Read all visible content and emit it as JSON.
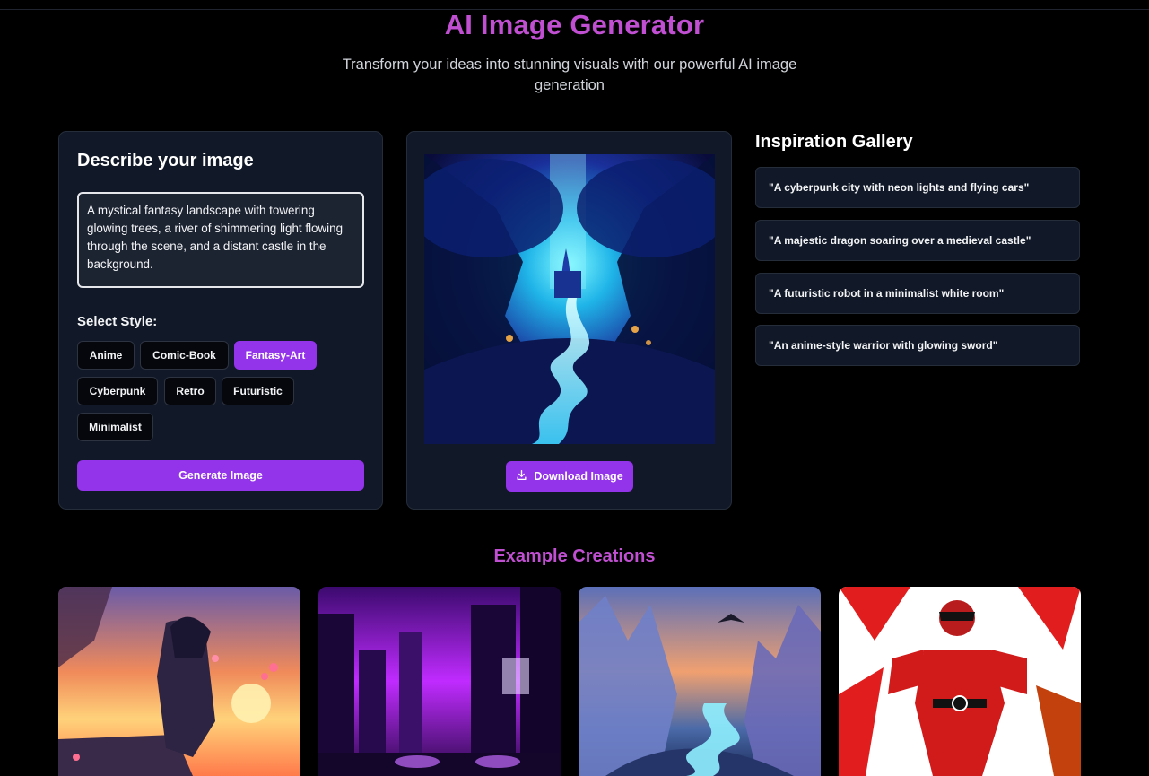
{
  "header": {
    "title": "AI Image Generator",
    "subtitle": "Transform your ideas into stunning visuals with our powerful AI image generation"
  },
  "describe": {
    "heading": "Describe your image",
    "prompt_value": "A mystical fantasy landscape with towering glowing trees, a river of shimmering light flowing through the scene, and a distant castle in the background.",
    "style_label": "Select Style:",
    "styles": [
      "Anime",
      "Comic-Book",
      "Fantasy-Art",
      "Cyberpunk",
      "Retro",
      "Futuristic",
      "Minimalist"
    ],
    "selected_style": "Fantasy-Art",
    "generate_label": "Generate Image"
  },
  "preview": {
    "image_icon": "fantasy-landscape-image",
    "download_label": "Download Image",
    "download_icon": "download-icon"
  },
  "gallery": {
    "title": "Inspiration Gallery",
    "items": [
      "\"A cyberpunk city with neon lights and flying cars\"",
      "\"A majestic dragon soaring over a medieval castle\"",
      "\"A futuristic robot in a minimalist white room\"",
      "\"An anime-style warrior with glowing sword\""
    ]
  },
  "examples": {
    "title": "Example Creations",
    "items": [
      "anime-warrior-sunset-image",
      "cyberpunk-city-image",
      "fantasy-crystal-valley-image",
      "comic-hero-image"
    ]
  },
  "colors": {
    "accent": "#9333ea",
    "title": "#c04fd1",
    "card": "#111827",
    "background": "#000000"
  }
}
